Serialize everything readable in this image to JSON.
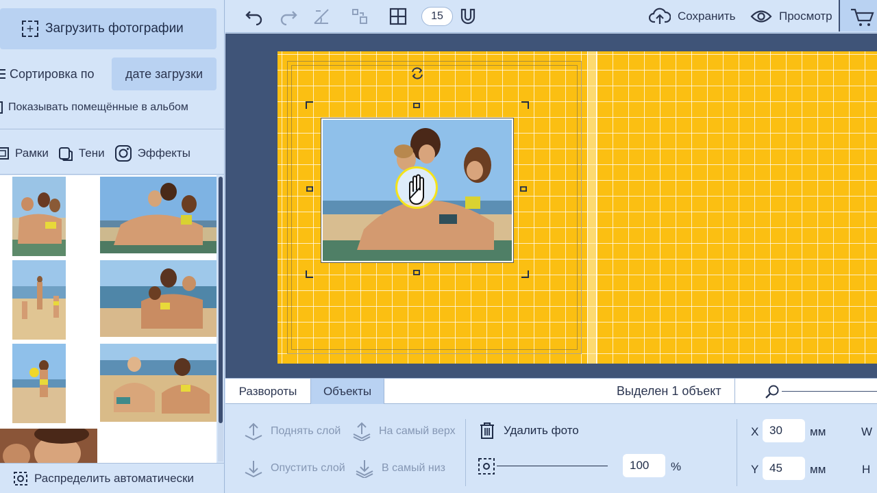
{
  "left_panel": {
    "upload_label": "Загрузить фотографии",
    "sort_label": "Сортировка по",
    "sort_value": "дате загрузки",
    "show_in_album_label": "Показывать помещённые в альбом",
    "tabs": [
      {
        "label": "Рамки",
        "icon": "frame-icon"
      },
      {
        "label": "Тени",
        "icon": "shadow-icon"
      },
      {
        "label": "Эффекты",
        "icon": "effects-icon"
      }
    ],
    "auto_distribute_label": "Распределить автоматически"
  },
  "toolbar": {
    "grid_size_value": "15",
    "save_label": "Сохранить",
    "preview_label": "Просмотр"
  },
  "bottom_tabs": {
    "spreads_label": "Развороты",
    "objects_label": "Объекты",
    "selection_status": "Выделен 1 объект"
  },
  "bottom_panel": {
    "raise_layer": "Поднять слой",
    "to_top": "На самый верх",
    "lower_layer": "Опустить слой",
    "to_bottom": "В самый низ",
    "delete_photo": "Удалить фото",
    "opacity_value": "100",
    "opacity_unit": "%",
    "x_label": "X",
    "x_value": "30",
    "y_label": "Y",
    "y_value": "45",
    "unit": "мм",
    "w_label": "W",
    "h_label": "H"
  },
  "colors": {
    "page_background": "#fbbf12",
    "canvas_background": "#3f5478",
    "panel_background": "#d4e4f8",
    "accent": "#b9d2f2"
  }
}
